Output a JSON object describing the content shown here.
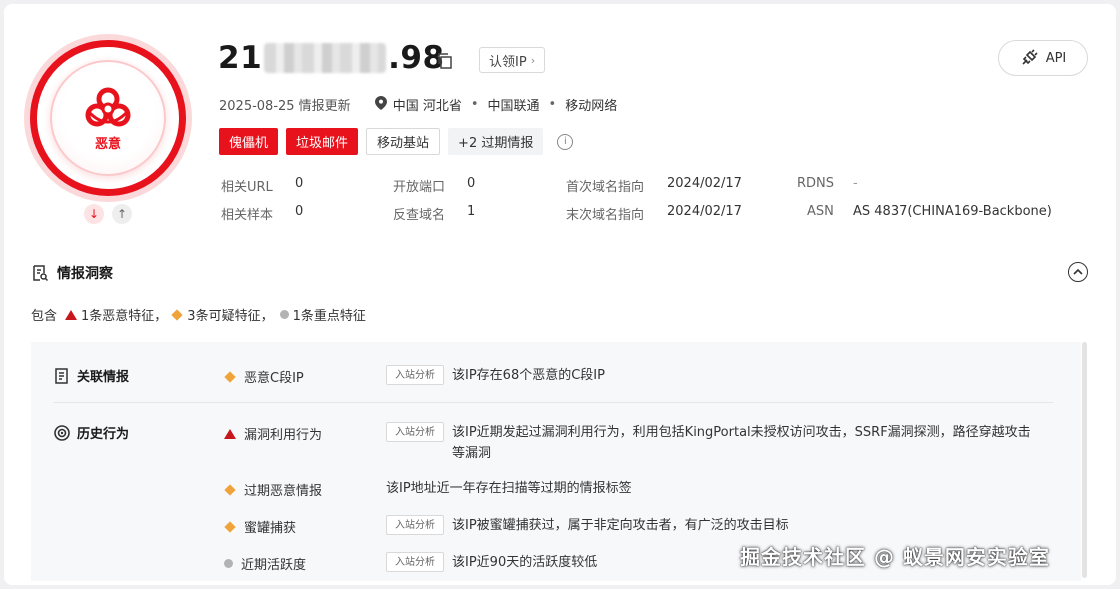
{
  "header": {
    "ip_prefix": "21",
    "ip_suffix": ".98",
    "claim_label": "认领IP",
    "api_label": "API",
    "update_text": "2025-08-25 情报更新",
    "location": "中国 河北省",
    "isp": "中国联通",
    "network": "移动网络"
  },
  "badge": {
    "label": "恶意",
    "color": "#e8121d"
  },
  "tags": {
    "t1": "傀儡机",
    "t2": "垃圾邮件",
    "t3": "移动基站",
    "expired": "+2 过期情报"
  },
  "stats": {
    "related_url_k": "相关URL",
    "related_url_v": "0",
    "related_sample_k": "相关样本",
    "related_sample_v": "0",
    "open_port_k": "开放端口",
    "open_port_v": "0",
    "reverse_domain_k": "反查域名",
    "reverse_domain_v": "1",
    "first_domain_k": "首次域名指向",
    "first_domain_v": "2024/02/17",
    "last_domain_k": "末次域名指向",
    "last_domain_v": "2024/02/17",
    "rdns_k": "RDNS",
    "rdns_v": "-",
    "asn_k": "ASN",
    "asn_v": "AS 4837(CHINA169-Backbone)"
  },
  "insight": {
    "title": "情报洞察",
    "summary_prefix": "包含",
    "malicious": "1条恶意特征，",
    "suspicious": "3条可疑特征，",
    "key": "1条重点特征"
  },
  "sections": {
    "related": "关联情报",
    "history": "历史行为"
  },
  "rows": {
    "r1_label": "恶意C段IP",
    "r1_tag": "入站分析",
    "r1_text": "该IP存在68个恶意的C段IP",
    "r2_label": "漏洞利用行为",
    "r2_tag": "入站分析",
    "r2_text": "该IP近期发起过漏洞利用行为，利用包括KingPortal未授权访问攻击，SSRF漏洞探测，路径穿越攻击等漏洞",
    "r3_label": "过期恶意情报",
    "r3_text": "该IP地址近一年存在扫描等过期的情报标签",
    "r4_label": "蜜罐捕获",
    "r4_tag": "入站分析",
    "r4_text": "该IP被蜜罐捕获过，属于非定向攻击者，有广泛的攻击目标",
    "r5_label": "近期活跃度",
    "r5_tag": "入站分析",
    "r5_text": "该IP近90天的活跃度较低"
  },
  "watermark": "掘金技术社区 @ 蚁景网安实验室"
}
